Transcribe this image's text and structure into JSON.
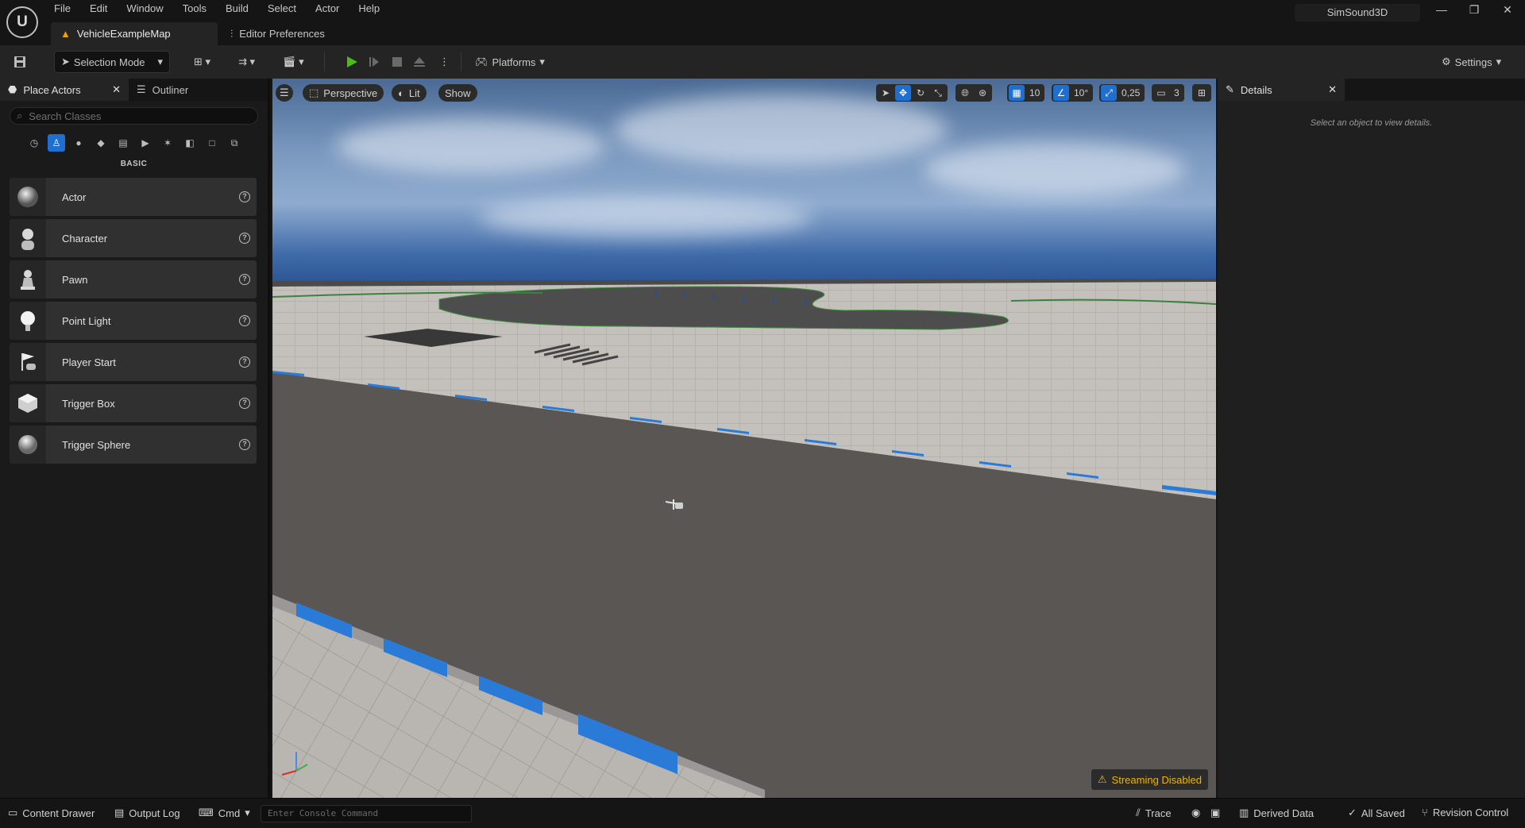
{
  "menu": [
    "File",
    "Edit",
    "Window",
    "Tools",
    "Build",
    "Select",
    "Actor",
    "Help"
  ],
  "project_name": "SimSound3D",
  "tabs": {
    "level": "VehicleExampleMap",
    "prefs": "Editor Preferences"
  },
  "toolbar": {
    "mode": "Selection Mode",
    "platforms": "Platforms",
    "settings": "Settings"
  },
  "left_panel": {
    "tab_place": "Place Actors",
    "tab_outliner": "Outliner",
    "search_placeholder": "Search Classes",
    "category": "BASIC",
    "items": [
      {
        "label": "Actor",
        "icon": "sphere-icon"
      },
      {
        "label": "Character",
        "icon": "character-icon"
      },
      {
        "label": "Pawn",
        "icon": "pawn-icon"
      },
      {
        "label": "Point Light",
        "icon": "light-bulb-icon"
      },
      {
        "label": "Player Start",
        "icon": "player-start-icon"
      },
      {
        "label": "Trigger Box",
        "icon": "trigger-box-icon"
      },
      {
        "label": "Trigger Sphere",
        "icon": "trigger-sphere-icon"
      }
    ]
  },
  "viewport": {
    "perspective": "Perspective",
    "lit": "Lit",
    "show": "Show",
    "grid": "10",
    "angle": "10°",
    "scale": "0,25",
    "cam": "3",
    "streaming": "Streaming Disabled"
  },
  "details": {
    "tab": "Details",
    "empty": "Select an object to view details."
  },
  "statusbar": {
    "content": "Content Drawer",
    "output": "Output Log",
    "cmd": "Cmd",
    "console_placeholder": "Enter Console Command",
    "trace": "Trace",
    "derived": "Derived Data",
    "saved": "All Saved",
    "revision": "Revision Control"
  },
  "colors": {
    "accent": "#1f6fd1",
    "warning": "#f0b400",
    "play": "#4cbb17"
  }
}
